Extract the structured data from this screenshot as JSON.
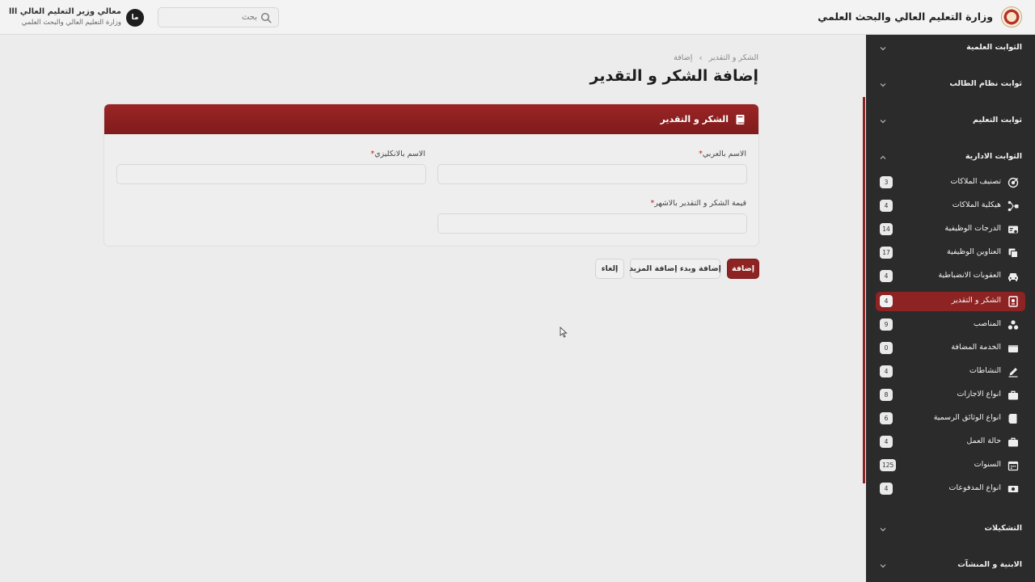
{
  "header": {
    "app_title": "وزارة التعليم العالي والبحث العلمي",
    "search_placeholder": "بحث",
    "user_initials": "ما",
    "user_name": "معالي وزير التعليم العالي ااا",
    "user_org": "وزارة التعليم العالي والبحث العلمي"
  },
  "breadcrumb": [
    "الشكر و التقدير",
    "إضافة"
  ],
  "page_title": "إضافة الشكر و التقدير",
  "form": {
    "card_title": "الشكر و التقدير",
    "fields": {
      "name_ar": {
        "label": "الاسم بالعربي",
        "value": ""
      },
      "name_en": {
        "label": "الاسم بالانكليزي",
        "value": ""
      },
      "months_value": {
        "label": "قيمة الشكر و التقدير بالاشهر",
        "value": ""
      }
    },
    "required_mark": "*",
    "buttons": {
      "add": "إضافة",
      "add_more": "إضافة وبدء إضافة المزيد",
      "cancel": "إلغاء"
    }
  },
  "sidebar": {
    "groups": [
      {
        "label": "الثوابت العلمية",
        "expanded": false
      },
      {
        "label": "ثوابت نظام الطالب",
        "expanded": false
      },
      {
        "label": "ثوابت التعليم",
        "expanded": false
      },
      {
        "label": "الثوابت الادارية",
        "expanded": true
      },
      {
        "label": "التشكيلات",
        "expanded": false
      },
      {
        "label": "الابنية و المنشآت",
        "expanded": false
      }
    ],
    "items": [
      {
        "label": "تصنيف الملاكات",
        "count": "3",
        "icon": "target-icon"
      },
      {
        "label": "هيكلية الملاكات",
        "count": "4",
        "icon": "hierarchy-icon"
      },
      {
        "label": "الدرجات الوظيفية",
        "count": "14",
        "icon": "id-card-icon"
      },
      {
        "label": "العناوين الوظيفية",
        "count": "17",
        "icon": "copy-icon"
      },
      {
        "label": "العقوبات الانضباطية",
        "count": "4",
        "icon": "car-icon"
      },
      {
        "label": "الشكر و التقدير",
        "count": "4",
        "icon": "certificate-icon",
        "active": true
      },
      {
        "label": "المناصب",
        "count": "9",
        "icon": "people-icon"
      },
      {
        "label": "الخدمة المضافة",
        "count": "0",
        "icon": "folder-icon"
      },
      {
        "label": "النشاطات",
        "count": "4",
        "icon": "pencil-icon"
      },
      {
        "label": "انواع الاجازات",
        "count": "8",
        "icon": "briefcase-icon"
      },
      {
        "label": "انواع الوثائق الرسمية",
        "count": "6",
        "icon": "document-icon"
      },
      {
        "label": "حالة العمل",
        "count": "4",
        "icon": "briefcase-icon"
      },
      {
        "label": "السنوات",
        "count": "125",
        "icon": "calendar-icon"
      },
      {
        "label": "انواع المدفوعات",
        "count": "4",
        "icon": "money-icon"
      }
    ]
  },
  "colors": {
    "brand": "#8e2323",
    "sidebar_bg": "#2b2b2b",
    "page_bg": "#ececec"
  }
}
